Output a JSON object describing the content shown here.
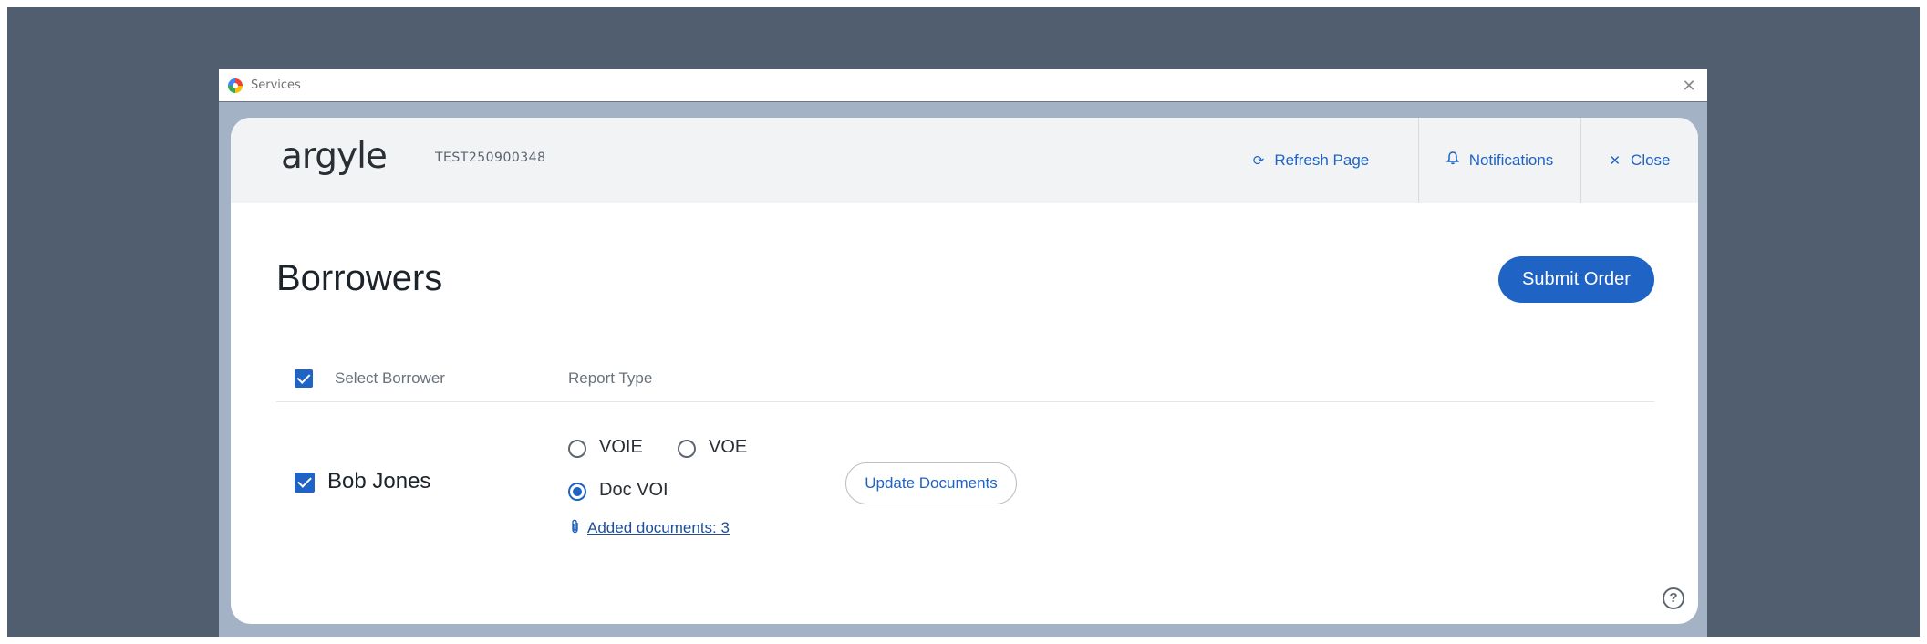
{
  "window": {
    "title": "Services"
  },
  "header": {
    "brand": "argyle",
    "order_id": "TEST250900348",
    "refresh_label": "Refresh Page",
    "notifications_label": "Notifications",
    "close_label": "Close"
  },
  "main": {
    "title": "Borrowers",
    "submit_label": "Submit Order",
    "columns": {
      "select": "Select Borrower",
      "report": "Report Type"
    },
    "borrower": {
      "name": "Bob Jones",
      "selected": true,
      "report_options": [
        "VOIE",
        "VOE",
        "Doc VOI"
      ],
      "selected_report": "Doc VOI",
      "documents_link": "Added documents: 3",
      "update_label": "Update Documents"
    },
    "help_glyph": "?"
  },
  "icons": {
    "refresh": "refresh-icon",
    "notifications": "bell-icon",
    "close": "close-icon",
    "attachment": "paperclip-icon",
    "help": "help-icon"
  },
  "colors": {
    "accent": "#1f63c5",
    "backdrop": "#515e70",
    "header_bg": "#f2f3f5"
  }
}
